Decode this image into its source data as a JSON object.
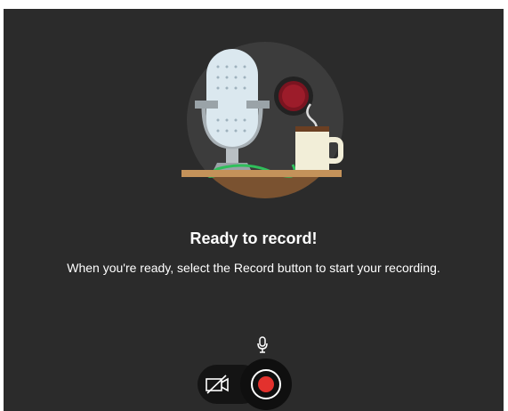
{
  "dialog": {
    "title": "Ready to record!",
    "message": "When you're ready, select the Record button to start your recording."
  },
  "icons": {
    "illustration": "microphone-coffee-illustration",
    "mic_indicator": "microphone-icon",
    "camera": "camera-off-icon",
    "record": "record-icon"
  },
  "colors": {
    "background": "#2b2b2b",
    "record_red": "#e3312d",
    "control_dark": "#141414"
  }
}
